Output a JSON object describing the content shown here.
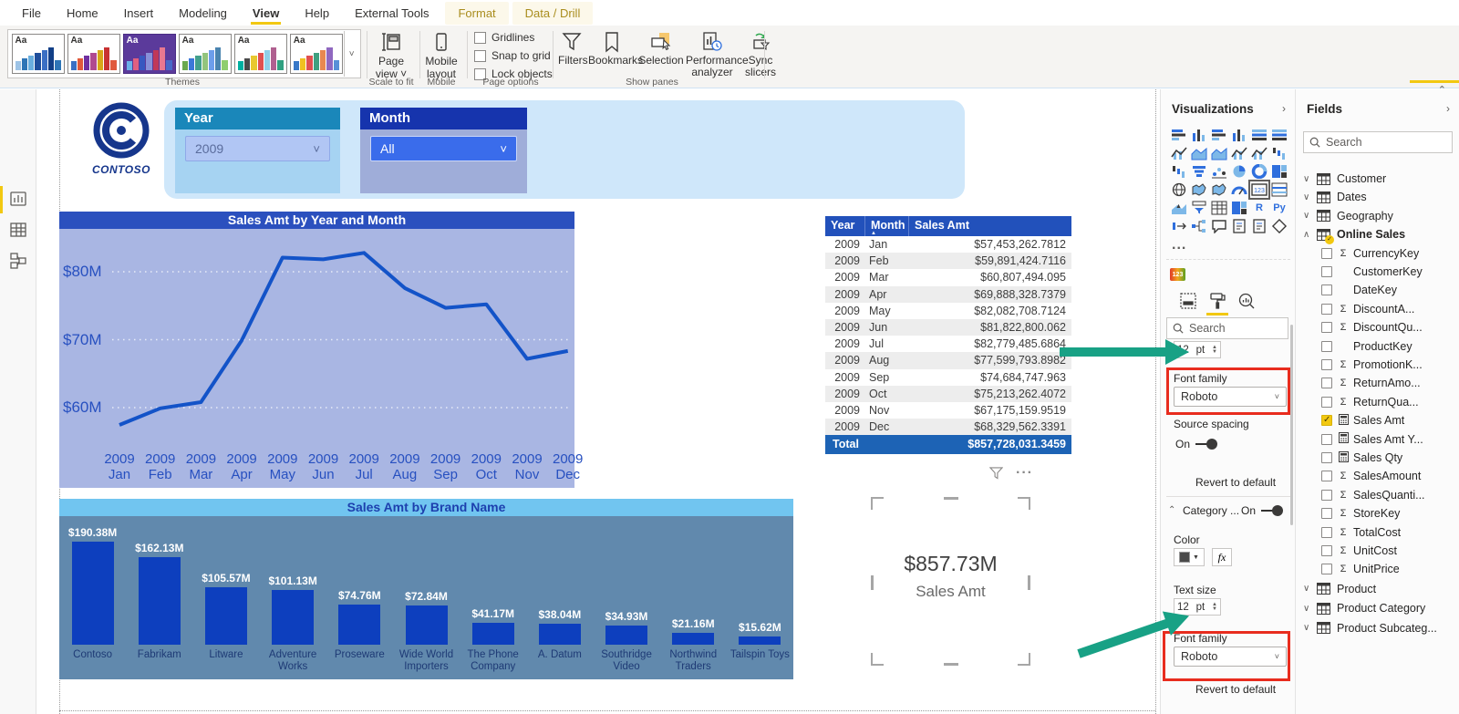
{
  "ribbon": {
    "tabs": [
      {
        "label": "File"
      },
      {
        "label": "Home"
      },
      {
        "label": "Insert"
      },
      {
        "label": "Modeling"
      },
      {
        "label": "View",
        "active": true
      },
      {
        "label": "Help"
      },
      {
        "label": "External Tools"
      },
      {
        "label": "Format",
        "accent": true
      },
      {
        "label": "Data / Drill",
        "accent": true
      }
    ],
    "themes_group_label": "Themes",
    "scale_group_label": "Scale to fit",
    "mobile_group_label": "Mobile",
    "page_options_group_label": "Page options",
    "show_panes_group_label": "Show panes",
    "page_view_label": "Page view",
    "mobile_layout_label": "Mobile layout",
    "page_option_checkboxes": [
      "Gridlines",
      "Snap to grid",
      "Lock objects"
    ],
    "show_panes_buttons": [
      {
        "label": "Filters",
        "icon": "filter-icon"
      },
      {
        "label": "Bookmarks",
        "icon": "bookmark-icon"
      },
      {
        "label": "Selection",
        "icon": "selection-icon"
      },
      {
        "label": "Performance analyzer",
        "icon": "performance-analyzer-icon"
      },
      {
        "label": "Sync slicers",
        "icon": "sync-slicers-icon"
      }
    ],
    "theme_palettes": [
      {
        "selected": false,
        "bg": "#ffffff",
        "bars": [
          "#9dc3e6",
          "#2e75b6",
          "#6aaede",
          "#1f4e9c",
          "#3a6fc4",
          "#123f87",
          "#2e75b6"
        ]
      },
      {
        "selected": false,
        "bg": "#ffffff",
        "bars": [
          "#3a6fc4",
          "#e0593c",
          "#7030a0",
          "#b04a8f",
          "#d8a618",
          "#c83232",
          "#e0593c"
        ]
      },
      {
        "selected": true,
        "bg": "#5b3a9b",
        "bars": [
          "#6ab0e8",
          "#e06080",
          "#3858c0",
          "#8890d8",
          "#c03858",
          "#e87890",
          "#4868c8"
        ]
      },
      {
        "selected": false,
        "bg": "#ffffff",
        "bars": [
          "#6aa84f",
          "#3c78d8",
          "#43a08c",
          "#93c47d",
          "#6d9eeb",
          "#4a84b0",
          "#8fce6e"
        ]
      },
      {
        "selected": false,
        "bg": "#ffffff",
        "bars": [
          "#00b0a0",
          "#4a4a4a",
          "#e8c830",
          "#e05050",
          "#90d0e8",
          "#b06090",
          "#30a080"
        ]
      },
      {
        "selected": false,
        "bg": "#ffffff",
        "bars": [
          "#3878c8",
          "#f0c020",
          "#e05050",
          "#40a080",
          "#e88850",
          "#9068c0",
          "#5890d8"
        ]
      }
    ]
  },
  "left_rail": {
    "items": [
      {
        "name": "report-view",
        "active": true
      },
      {
        "name": "data-view",
        "active": false
      },
      {
        "name": "model-view",
        "active": false
      }
    ]
  },
  "canvas": {
    "logo_text": "CONTOSO",
    "slicers": [
      {
        "title": "Year",
        "value": "2009",
        "header_color": "#1a87ba",
        "body_color": "#a6d3f2",
        "dd_bg": "#b1c6f4",
        "dd_border": "#8fa9e8",
        "dd_text_color": "#5a6c9c"
      },
      {
        "title": "Month",
        "value": "All",
        "header_color": "#1634ad",
        "body_color": "#9fadd9",
        "dd_bg": "#3a6ceb",
        "dd_border": "#c9d6f8",
        "dd_text_color": "#ffffff"
      }
    ],
    "card_menu_icons": [
      "filter-funnel-icon",
      "ellipsis-icon"
    ]
  },
  "chart_data": [
    {
      "type": "line",
      "title": "Sales Amt by Year and Month",
      "series_name": "Sales Amt",
      "x": [
        "2009 Jan",
        "2009 Feb",
        "2009 Mar",
        "2009 Apr",
        "2009 May",
        "2009 Jun",
        "2009 Jul",
        "2009 Aug",
        "2009 Sep",
        "2009 Oct",
        "2009 Nov",
        "2009 Dec"
      ],
      "values_millions": [
        57.45,
        59.89,
        60.81,
        69.89,
        82.08,
        81.82,
        82.78,
        77.6,
        74.68,
        75.21,
        67.18,
        68.33
      ],
      "y_ticks": [
        {
          "label": "$60M",
          "value": 60
        },
        {
          "label": "$70M",
          "value": 70
        },
        {
          "label": "$80M",
          "value": 80
        }
      ],
      "ylim": [
        55,
        86.5
      ],
      "grid": "dotted-white",
      "line_color": "#1353c8",
      "title_bg": "#2b50be",
      "title_color": "#ffffff",
      "plot_bg": "#a9b6e3"
    },
    {
      "type": "bar",
      "title": "Sales Amt by Brand Name",
      "categories": [
        "Contoso",
        "Fabrikam",
        "Litware",
        "Adventure Works",
        "Proseware",
        "Wide World Importers",
        "The Phone Company",
        "A. Datum",
        "Southridge Video",
        "Northwind Traders",
        "Tailspin Toys"
      ],
      "values_millions": [
        190.38,
        162.13,
        105.57,
        101.13,
        74.76,
        72.84,
        41.17,
        38.04,
        34.93,
        21.16,
        15.62
      ],
      "data_labels": [
        "$190.38M",
        "$162.13M",
        "$105.57M",
        "$101.13M",
        "$74.76M",
        "$72.84M",
        "$41.17M",
        "$38.04M",
        "$34.93M",
        "$21.16M",
        "$15.62M"
      ],
      "ylim": [
        0,
        200
      ],
      "bar_color": "#0d3fbe",
      "title_bg": "#71c5f0",
      "title_color": "#1d3fae",
      "plot_bg": "#6189ad"
    },
    {
      "type": "table",
      "headers": [
        "Year",
        "Month",
        "Sales Amt"
      ],
      "sorted_by": "Month",
      "rows": [
        [
          "2009",
          "Jan",
          "$57,453,262.7812"
        ],
        [
          "2009",
          "Feb",
          "$59,891,424.7116"
        ],
        [
          "2009",
          "Mar",
          "$60,807,494.095"
        ],
        [
          "2009",
          "Apr",
          "$69,888,328.7379"
        ],
        [
          "2009",
          "May",
          "$82,082,708.7124"
        ],
        [
          "2009",
          "Jun",
          "$81,822,800.062"
        ],
        [
          "2009",
          "Jul",
          "$82,779,485.6864"
        ],
        [
          "2009",
          "Aug",
          "$77,599,793.8982"
        ],
        [
          "2009",
          "Sep",
          "$74,684,747.963"
        ],
        [
          "2009",
          "Oct",
          "$75,213,262.4072"
        ],
        [
          "2009",
          "Nov",
          "$67,175,159.9519"
        ],
        [
          "2009",
          "Dec",
          "$68,329,562.3391"
        ]
      ],
      "total_row": {
        "label": "Total",
        "value": "$857,728,031.3459"
      }
    },
    {
      "type": "card",
      "value": "$857.73M",
      "label": "Sales Amt"
    }
  ],
  "visualizations_pane": {
    "title": "Visualizations",
    "more": "...",
    "selected_visual": "card",
    "icons": [
      "stacked-bar-chart",
      "stacked-column-chart",
      "clustered-bar-chart",
      "clustered-column-chart",
      "stacked-bar-100-chart",
      "stacked-column-100-chart",
      "line-chart",
      "area-chart",
      "stacked-area-chart",
      "line-stacked-column-chart",
      "line-clustered-column-chart",
      "ribbon-chart",
      "waterfall-chart",
      "funnel-chart",
      "scatter-chart",
      "pie-chart",
      "donut-chart",
      "treemap",
      "map",
      "filled-map",
      "shape-map",
      "gauge",
      "card",
      "multi-row-card",
      "kpi",
      "slicer",
      "table",
      "matrix",
      "r-script",
      "python-script",
      "power-apps",
      "decomposition-tree",
      "qa-visual",
      "smart-narrative",
      "paginated-report",
      "arcgis-map"
    ],
    "custom_visual_label": "123",
    "format_tabs": [
      "fields-tab",
      "format-tab",
      "analytics-tab"
    ],
    "active_format_tab": "format-tab"
  },
  "format_pane": {
    "search_placeholder": "Search",
    "size_value": "12",
    "size_unit": "pt",
    "font_family_label": "Font family",
    "font_family_value": "Roboto",
    "source_spacing_label": "Source spacing",
    "on_label": "On",
    "revert_label": "Revert to default",
    "category_section_label": "Category ...",
    "category_on_label": "On",
    "color_label": "Color",
    "fx_label": "fx",
    "text_size_label": "Text size",
    "text_size_value": "12",
    "text_size_unit": "pt",
    "font_family_label_2": "Font family",
    "font_family_value_2": "Roboto",
    "revert_label_2": "Revert to default"
  },
  "fields_pane": {
    "title": "Fields",
    "search_placeholder": "Search",
    "tables_before": [
      {
        "name": "Customer"
      },
      {
        "name": "Dates"
      },
      {
        "name": "Geography"
      }
    ],
    "expanded_table": {
      "name": "Online Sales"
    },
    "fields": [
      {
        "name": "CurrencyKey",
        "icon": "sigma",
        "checked": false
      },
      {
        "name": "CustomerKey",
        "icon": "none",
        "checked": false
      },
      {
        "name": "DateKey",
        "icon": "none",
        "checked": false
      },
      {
        "name": "DiscountA...",
        "icon": "sigma",
        "checked": false
      },
      {
        "name": "DiscountQu...",
        "icon": "sigma",
        "checked": false
      },
      {
        "name": "ProductKey",
        "icon": "none",
        "checked": false
      },
      {
        "name": "PromotionK...",
        "icon": "sigma",
        "checked": false
      },
      {
        "name": "ReturnAmo...",
        "icon": "sigma",
        "checked": false
      },
      {
        "name": "ReturnQua...",
        "icon": "sigma",
        "checked": false
      },
      {
        "name": "Sales Amt",
        "icon": "measure",
        "checked": true
      },
      {
        "name": "Sales Amt Y...",
        "icon": "measure",
        "checked": false
      },
      {
        "name": "Sales Qty",
        "icon": "measure",
        "checked": false
      },
      {
        "name": "SalesAmount",
        "icon": "sigma",
        "checked": false
      },
      {
        "name": "SalesQuanti...",
        "icon": "sigma",
        "checked": false
      },
      {
        "name": "StoreKey",
        "icon": "sigma",
        "checked": false
      },
      {
        "name": "TotalCost",
        "icon": "sigma",
        "checked": false
      },
      {
        "name": "UnitCost",
        "icon": "sigma",
        "checked": false
      },
      {
        "name": "UnitPrice",
        "icon": "sigma",
        "checked": false
      }
    ],
    "tables_after": [
      {
        "name": "Product"
      },
      {
        "name": "Product Category"
      },
      {
        "name": "Product Subcateg..."
      }
    ]
  },
  "annotations": {
    "arrow_color": "#18a185",
    "highlight_color": "#e82c1e"
  }
}
